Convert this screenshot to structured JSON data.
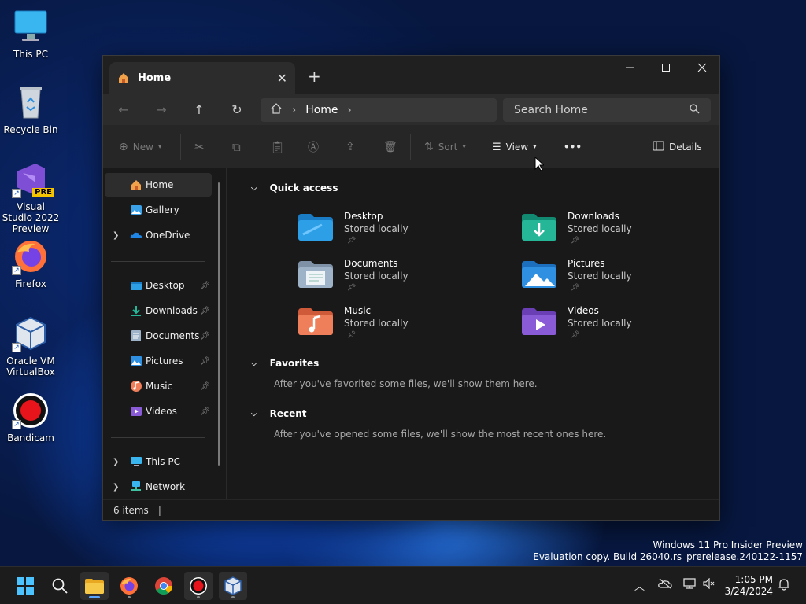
{
  "desktop": {
    "icons": [
      {
        "label": "This PC",
        "icon": "monitor-icon"
      },
      {
        "label": "Recycle Bin",
        "icon": "recycle-bin-icon"
      },
      {
        "label": "Visual Studio 2022 Preview",
        "icon": "visual-studio-icon",
        "badge": "PRE"
      },
      {
        "label": "Firefox",
        "icon": "firefox-icon"
      },
      {
        "label": "Oracle VM VirtualBox",
        "icon": "virtualbox-icon"
      },
      {
        "label": "Bandicam",
        "icon": "bandicam-icon"
      }
    ],
    "watermark_line1": "Windows 11 Pro Insider Preview",
    "watermark_line2": "Evaluation copy. Build 26040.rs_prerelease.240122-1157"
  },
  "explorer": {
    "tab_title": "Home",
    "new_tab": "+",
    "address": {
      "crumb": "Home"
    },
    "search": {
      "placeholder": "Search Home"
    },
    "toolbar": {
      "new_label": "New",
      "sort_label": "Sort",
      "view_label": "View",
      "more_label": "•••",
      "details_label": "Details"
    },
    "sidebar": {
      "top": [
        {
          "label": "Home",
          "icon": "home-icon",
          "selected": true
        },
        {
          "label": "Gallery",
          "icon": "gallery-icon"
        },
        {
          "label": "OneDrive",
          "icon": "cloud-icon",
          "expandable": true
        }
      ],
      "pinned": [
        {
          "label": "Desktop",
          "icon": "desktop-folder-icon"
        },
        {
          "label": "Downloads",
          "icon": "download-icon"
        },
        {
          "label": "Documents",
          "icon": "documents-icon"
        },
        {
          "label": "Pictures",
          "icon": "pictures-icon"
        },
        {
          "label": "Music",
          "icon": "music-icon"
        },
        {
          "label": "Videos",
          "icon": "videos-icon"
        }
      ],
      "bottom": [
        {
          "label": "This PC",
          "icon": "monitor-icon"
        },
        {
          "label": "Network",
          "icon": "network-icon"
        }
      ]
    },
    "quick_access": {
      "title": "Quick access",
      "items": [
        {
          "name": "Desktop",
          "status": "Stored locally",
          "color": "#2d9fe6"
        },
        {
          "name": "Downloads",
          "status": "Stored locally",
          "color": "#25b597"
        },
        {
          "name": "Documents",
          "status": "Stored locally",
          "color": "#9fb3c8"
        },
        {
          "name": "Pictures",
          "status": "Stored locally",
          "color": "#2f8fe0"
        },
        {
          "name": "Music",
          "status": "Stored locally",
          "color": "#ef7e5a"
        },
        {
          "name": "Videos",
          "status": "Stored locally",
          "color": "#8a5bd6"
        }
      ]
    },
    "favorites": {
      "title": "Favorites",
      "message": "After you've favorited some files, we'll show them here."
    },
    "recent": {
      "title": "Recent",
      "message": "After you've opened some files, we'll show the most recent ones here."
    },
    "status_text": "6 items"
  },
  "taskbar": {
    "time": "1:05 PM",
    "date": "3/24/2024"
  }
}
